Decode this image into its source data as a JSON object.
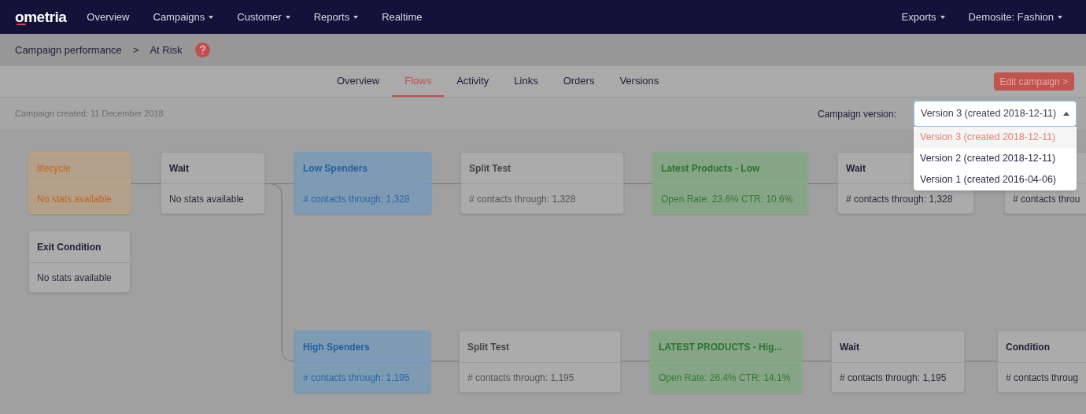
{
  "nav": {
    "logo": "ometria",
    "items": [
      {
        "label": "Overview",
        "dropdown": false
      },
      {
        "label": "Campaigns",
        "dropdown": true
      },
      {
        "label": "Customer",
        "dropdown": true
      },
      {
        "label": "Reports",
        "dropdown": true
      },
      {
        "label": "Realtime",
        "dropdown": false
      }
    ],
    "right_items": [
      {
        "label": "Exports",
        "dropdown": true
      },
      {
        "label": "Demosite: Fashion",
        "dropdown": true
      }
    ]
  },
  "breadcrumb": [
    "Campaign performance",
    ">",
    "At Risk"
  ],
  "tabs": [
    {
      "label": "Overview",
      "selected": false
    },
    {
      "label": "Flows",
      "selected": true
    },
    {
      "label": "Activity",
      "selected": false
    },
    {
      "label": "Links",
      "selected": false
    },
    {
      "label": "Orders",
      "selected": false
    },
    {
      "label": "Versions",
      "selected": false
    }
  ],
  "edit_button": "Edit campaign >",
  "created": "Campaign created: 11 December 2018",
  "version_select": {
    "label": "Campaign version:",
    "value": "Version 3 (created 2018-12-11)",
    "expanded": true,
    "options": [
      {
        "label": "Version 3 (created 2018-12-11)",
        "selected": true
      },
      {
        "label": "Version 2 (created 2018-12-11)",
        "selected": false
      },
      {
        "label": "Version 1 (created 2016-04-06)",
        "selected": false
      }
    ]
  },
  "flow": {
    "nodes": [
      {
        "kind": "trigger",
        "title": "lifecycle",
        "body": "No stats available"
      },
      {
        "kind": "step",
        "title": "Wait",
        "body": "No stats available"
      },
      {
        "kind": "segment",
        "title": "Low Spenders",
        "body": "# contacts through: 1,328"
      },
      {
        "kind": "split",
        "title": "Split Test",
        "body": "# contacts through: 1,328"
      },
      {
        "kind": "email",
        "title": "Latest Products - Low",
        "body": "Open Rate: 23.6% CTR: 10.6%"
      },
      {
        "kind": "step",
        "title": "Wait",
        "body": "# contacts through: 1,328"
      },
      {
        "kind": "step",
        "body": "# contacts throu"
      },
      {
        "kind": "step",
        "title": "Exit Condition",
        "body": "No stats available"
      },
      {
        "kind": "segment",
        "title": "High Spenders",
        "body": "# contacts through: 1,195"
      },
      {
        "kind": "split",
        "title": "Split Test",
        "body": "# contacts through: 1,195"
      },
      {
        "kind": "email",
        "title": "LATEST PRODUCTS - Hig...",
        "body": "Open Rate: 26.4% CTR: 14.1%"
      },
      {
        "kind": "step",
        "title": "Wait",
        "body": "# contacts through: 1,195"
      },
      {
        "kind": "step",
        "title": "Condition",
        "body": "# contacts throug"
      }
    ]
  }
}
